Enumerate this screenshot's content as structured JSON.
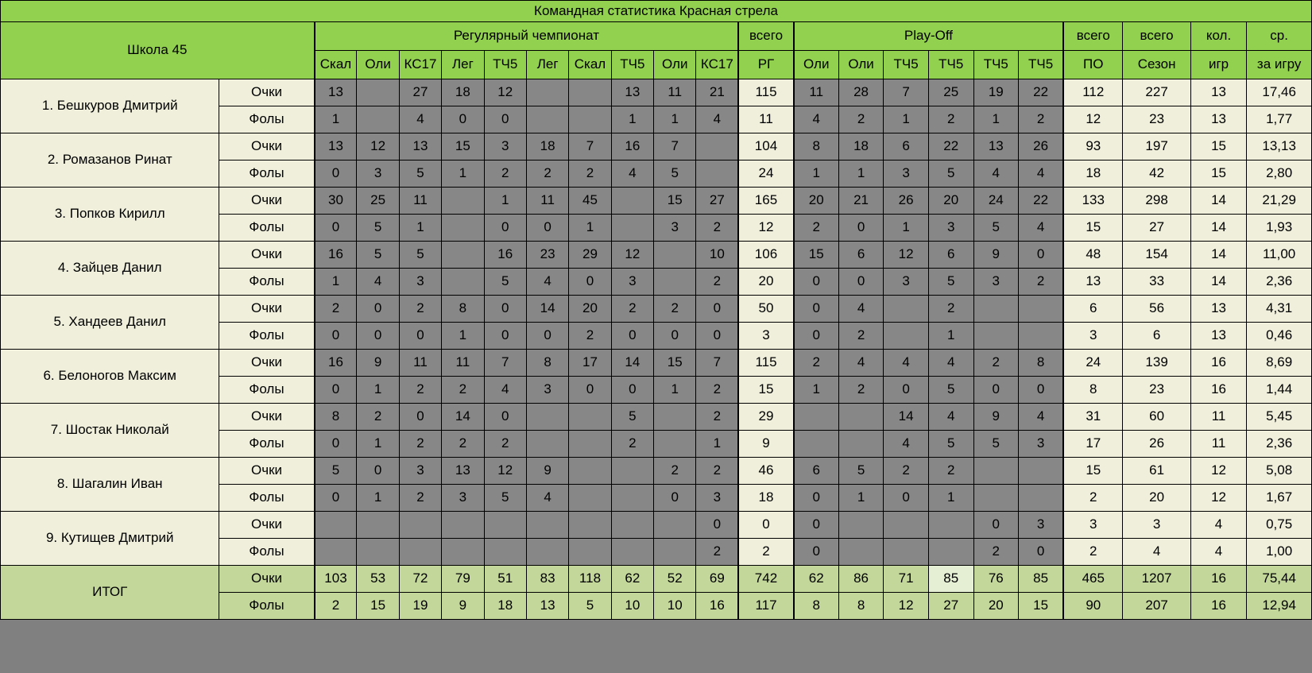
{
  "title": "Командная статистика Красная стрела",
  "team_label": "Школа 45",
  "groups": {
    "regular": "Регулярный чемпионат",
    "playoff": "Play-Off",
    "total_rg_top": "всего",
    "total_rg_bottom": "РГ",
    "total_po_top": "всего",
    "total_po_bottom": "ПО",
    "total_season_top": "всего",
    "total_season_bottom": "Сезон",
    "games_top": "кол.",
    "games_bottom": "игр",
    "avg_top": "ср.",
    "avg_bottom": "за игру"
  },
  "regular_columns": [
    "Скал",
    "Оли",
    "КС17",
    "Лег",
    "ТЧ5",
    "Лег",
    "Скал",
    "ТЧ5",
    "Оли",
    "КС17"
  ],
  "playoff_columns": [
    "Оли",
    "Оли",
    "ТЧ5",
    "ТЧ5",
    "ТЧ5",
    "ТЧ5"
  ],
  "metrics": {
    "points": "Очки",
    "fouls": "Фолы"
  },
  "total_label": "ИТОГ",
  "chart_data": {
    "type": "table",
    "title": "Командная статистика Красная стрела",
    "players": [
      {
        "name": "1. Бешкуров Дмитрий",
        "points": {
          "regular": [
            "13",
            "",
            "27",
            "18",
            "12",
            "",
            "",
            "13",
            "11",
            "21"
          ],
          "total_rg": "115",
          "playoff": [
            "11",
            "28",
            "7",
            "25",
            "19",
            "22"
          ],
          "total_po": "112",
          "total_season": "227",
          "games": "13",
          "avg": "17,46"
        },
        "fouls": {
          "regular": [
            "1",
            "",
            "4",
            "0",
            "0",
            "",
            "",
            "1",
            "1",
            "4"
          ],
          "total_rg": "11",
          "playoff": [
            "4",
            "2",
            "1",
            "2",
            "1",
            "2"
          ],
          "total_po": "12",
          "total_season": "23",
          "games": "13",
          "avg": "1,77"
        }
      },
      {
        "name": "2. Ромазанов Ринат",
        "points": {
          "regular": [
            "13",
            "12",
            "13",
            "15",
            "3",
            "18",
            "7",
            "16",
            "7",
            ""
          ],
          "total_rg": "104",
          "playoff": [
            "8",
            "18",
            "6",
            "22",
            "13",
            "26"
          ],
          "total_po": "93",
          "total_season": "197",
          "games": "15",
          "avg": "13,13"
        },
        "fouls": {
          "regular": [
            "0",
            "3",
            "5",
            "1",
            "2",
            "2",
            "2",
            "4",
            "5",
            ""
          ],
          "total_rg": "24",
          "playoff": [
            "1",
            "1",
            "3",
            "5",
            "4",
            "4"
          ],
          "total_po": "18",
          "total_season": "42",
          "games": "15",
          "avg": "2,80"
        }
      },
      {
        "name": "3. Попков Кирилл",
        "points": {
          "regular": [
            "30",
            "25",
            "11",
            "",
            "1",
            "11",
            "45",
            "",
            "15",
            "27"
          ],
          "total_rg": "165",
          "playoff": [
            "20",
            "21",
            "26",
            "20",
            "24",
            "22"
          ],
          "total_po": "133",
          "total_season": "298",
          "games": "14",
          "avg": "21,29"
        },
        "fouls": {
          "regular": [
            "0",
            "5",
            "1",
            "",
            "0",
            "0",
            "1",
            "",
            "3",
            "2"
          ],
          "total_rg": "12",
          "playoff": [
            "2",
            "0",
            "1",
            "3",
            "5",
            "4"
          ],
          "total_po": "15",
          "total_season": "27",
          "games": "14",
          "avg": "1,93"
        }
      },
      {
        "name": "4. Зайцев Данил",
        "points": {
          "regular": [
            "16",
            "5",
            "5",
            "",
            "16",
            "23",
            "29",
            "12",
            "",
            "10"
          ],
          "total_rg": "106",
          "playoff": [
            "15",
            "6",
            "12",
            "6",
            "9",
            "0"
          ],
          "total_po": "48",
          "total_season": "154",
          "games": "14",
          "avg": "11,00"
        },
        "fouls": {
          "regular": [
            "1",
            "4",
            "3",
            "",
            "5",
            "4",
            "0",
            "3",
            "",
            "2"
          ],
          "total_rg": "20",
          "playoff": [
            "0",
            "0",
            "3",
            "5",
            "3",
            "2"
          ],
          "total_po": "13",
          "total_season": "33",
          "games": "14",
          "avg": "2,36"
        }
      },
      {
        "name": "5. Хандеев Данил",
        "points": {
          "regular": [
            "2",
            "0",
            "2",
            "8",
            "0",
            "14",
            "20",
            "2",
            "2",
            "0"
          ],
          "total_rg": "50",
          "playoff": [
            "0",
            "4",
            "",
            "2",
            "",
            ""
          ],
          "total_po": "6",
          "total_season": "56",
          "games": "13",
          "avg": "4,31"
        },
        "fouls": {
          "regular": [
            "0",
            "0",
            "0",
            "1",
            "0",
            "0",
            "2",
            "0",
            "0",
            "0"
          ],
          "total_rg": "3",
          "playoff": [
            "0",
            "2",
            "",
            "1",
            "",
            ""
          ],
          "total_po": "3",
          "total_season": "6",
          "games": "13",
          "avg": "0,46"
        }
      },
      {
        "name": "6. Белоногов Максим",
        "points": {
          "regular": [
            "16",
            "9",
            "11",
            "11",
            "7",
            "8",
            "17",
            "14",
            "15",
            "7"
          ],
          "total_rg": "115",
          "playoff": [
            "2",
            "4",
            "4",
            "4",
            "2",
            "8"
          ],
          "total_po": "24",
          "total_season": "139",
          "games": "16",
          "avg": "8,69"
        },
        "fouls": {
          "regular": [
            "0",
            "1",
            "2",
            "2",
            "4",
            "3",
            "0",
            "0",
            "1",
            "2"
          ],
          "total_rg": "15",
          "playoff": [
            "1",
            "2",
            "0",
            "5",
            "0",
            "0"
          ],
          "total_po": "8",
          "total_season": "23",
          "games": "16",
          "avg": "1,44"
        }
      },
      {
        "name": "7. Шостак Николай",
        "points": {
          "regular": [
            "8",
            "2",
            "0",
            "14",
            "0",
            "",
            "",
            "5",
            "",
            "2"
          ],
          "total_rg": "29",
          "playoff": [
            "",
            "",
            "14",
            "4",
            "9",
            "4"
          ],
          "total_po": "31",
          "total_season": "60",
          "games": "11",
          "avg": "5,45"
        },
        "fouls": {
          "regular": [
            "0",
            "1",
            "2",
            "2",
            "2",
            "",
            "",
            "2",
            "",
            "1"
          ],
          "total_rg": "9",
          "playoff": [
            "",
            "",
            "4",
            "5",
            "5",
            "3"
          ],
          "total_po": "17",
          "total_season": "26",
          "games": "11",
          "avg": "2,36"
        }
      },
      {
        "name": "8. Шагалин Иван",
        "points": {
          "regular": [
            "5",
            "0",
            "3",
            "13",
            "12",
            "9",
            "",
            "",
            "2",
            "2"
          ],
          "total_rg": "46",
          "playoff": [
            "6",
            "5",
            "2",
            "2",
            "",
            ""
          ],
          "total_po": "15",
          "total_season": "61",
          "games": "12",
          "avg": "5,08"
        },
        "fouls": {
          "regular": [
            "0",
            "1",
            "2",
            "3",
            "5",
            "4",
            "",
            "",
            "0",
            "3"
          ],
          "total_rg": "18",
          "playoff": [
            "0",
            "1",
            "0",
            "1",
            "",
            ""
          ],
          "total_po": "2",
          "total_season": "20",
          "games": "12",
          "avg": "1,67"
        }
      },
      {
        "name": "9. Кутищев Дмитрий",
        "points": {
          "regular": [
            "",
            "",
            "",
            "",
            "",
            "",
            "",
            "",
            "",
            "0"
          ],
          "total_rg": "0",
          "playoff": [
            "0",
            "",
            "",
            "",
            "0",
            "3"
          ],
          "total_po": "3",
          "total_season": "3",
          "games": "4",
          "avg": "0,75"
        },
        "fouls": {
          "regular": [
            "",
            "",
            "",
            "",
            "",
            "",
            "",
            "",
            "",
            "2"
          ],
          "total_rg": "2",
          "playoff": [
            "0",
            "",
            "",
            "",
            "2",
            "0"
          ],
          "total_po": "2",
          "total_season": "4",
          "games": "4",
          "avg": "1,00"
        }
      }
    ],
    "total": {
      "points": {
        "regular": [
          "103",
          "53",
          "72",
          "79",
          "51",
          "83",
          "118",
          "62",
          "52",
          "69"
        ],
        "total_rg": "742",
        "playoff": [
          "62",
          "86",
          "71",
          "85",
          "76",
          "85"
        ],
        "total_po": "465",
        "total_season": "1207",
        "games": "16",
        "avg": "75,44"
      },
      "fouls": {
        "regular": [
          "2",
          "15",
          "19",
          "9",
          "18",
          "13",
          "5",
          "10",
          "10",
          "16"
        ],
        "total_rg": "117",
        "playoff": [
          "8",
          "8",
          "12",
          "27",
          "20",
          "15"
        ],
        "total_po": "90",
        "total_season": "207",
        "games": "16",
        "avg": "12,94"
      }
    }
  },
  "colors": {
    "header_green": "#92D050",
    "total_green": "#C3D79B",
    "cell_light": "#EFEFDC",
    "cell_grey": "#878787",
    "highlight": "#E4EFD4"
  }
}
